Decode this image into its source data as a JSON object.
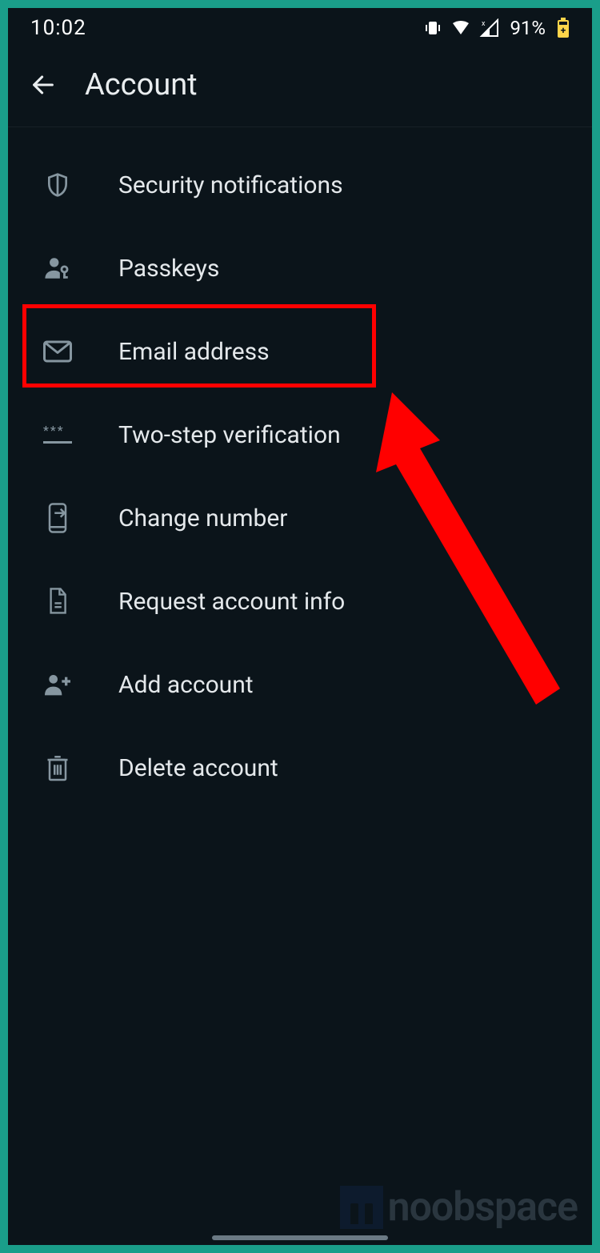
{
  "status": {
    "time": "10:02",
    "battery_pct": "91%"
  },
  "header": {
    "title": "Account"
  },
  "menu": {
    "items": [
      {
        "id": "security-notifications",
        "label": "Security notifications",
        "icon": "shield-icon"
      },
      {
        "id": "passkeys",
        "label": "Passkeys",
        "icon": "passkeys-icon"
      },
      {
        "id": "email-address",
        "label": "Email address",
        "icon": "email-icon"
      },
      {
        "id": "two-step-verification",
        "label": "Two-step verification",
        "icon": "password-icon"
      },
      {
        "id": "change-number",
        "label": "Change number",
        "icon": "change-number-icon"
      },
      {
        "id": "request-account-info",
        "label": "Request account info",
        "icon": "document-icon"
      },
      {
        "id": "add-account",
        "label": "Add account",
        "icon": "person-add-icon"
      },
      {
        "id": "delete-account",
        "label": "Delete account",
        "icon": "trash-icon"
      }
    ]
  },
  "annotation": {
    "highlighted_item": "email-address",
    "arrow_target": "email-address"
  },
  "watermark": {
    "text": "noobspace"
  }
}
